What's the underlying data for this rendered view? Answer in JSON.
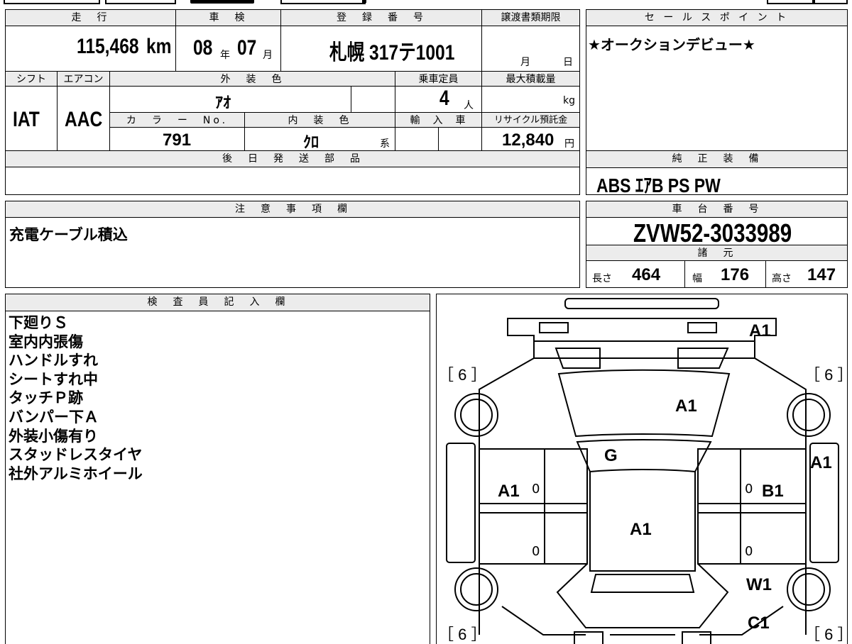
{
  "header": {
    "mileage_label": "走　行",
    "inspection_label": "車　検",
    "registration_label": "登　録　番　号",
    "transfer_label": "譲渡書類期限",
    "sales_point_label": "セ ー ル ス ポ イ ン ト"
  },
  "mileage": {
    "value": "115,468",
    "unit": "km"
  },
  "inspection": {
    "year": "08",
    "year_unit": "年",
    "month": "07",
    "month_unit": "月"
  },
  "registration": {
    "value": "札幌 317テ1001"
  },
  "transfer": {
    "month_unit": "月",
    "day_unit": "日"
  },
  "sales_point": {
    "text": "★オークションデビュー★"
  },
  "labels": {
    "shift": "シフト",
    "aircon": "エアコン",
    "exterior_color": "外　装　色",
    "capacity": "乗車定員",
    "max_load": "最大積載量",
    "color_no": "カ　ラ　ー　No.",
    "interior_color": "内　装　色",
    "import": "輸　入　車",
    "recycle": "リサイクル預託金",
    "later_parts": "後　日　発　送　部　品",
    "genuine_equipment": "純　正　装　備",
    "notes_label": "注　意　事　項　欄",
    "chassis_label": "車　台　番　号",
    "specs_label": "諸　元",
    "inspector_label": "検　査　員　記　入　欄"
  },
  "vehicle": {
    "shift": "IAT",
    "aircon": "AAC",
    "exterior_color": "ｱｵ",
    "capacity": "4",
    "capacity_unit": "人",
    "load_unit": "kg",
    "color_no": "791",
    "interior_color": "ｸﾛ",
    "interior_suffix": "系",
    "recycle_fee": "12,840",
    "recycle_unit": "円",
    "equipment": "ABS ｴｱB PS PW",
    "chassis_no": "ZVW52-3033989",
    "length_label": "長さ",
    "length": "464",
    "width_label": "幅",
    "width": "176",
    "height_label": "高さ",
    "height": "147"
  },
  "notes": {
    "text": "充電ケーブル積込"
  },
  "inspector_notes": [
    "下廻りＳ",
    "室内内張傷",
    "ハンドルすれ",
    "シートすれ中",
    "タッチＰ跡",
    "バンパー下Ａ",
    "外装小傷有り",
    "スタッドレスタイヤ",
    "社外アルミホイール"
  ],
  "diagram": {
    "tire_left_front": "［ 6 ］",
    "tire_right_front": "［ 6 ］",
    "tire_left_rear": "［ 6 ］",
    "tire_right_rear": "［ 6 ］",
    "front_bumper": "A1",
    "hood": "A1",
    "windshield": "G",
    "right_front_fender": "A1",
    "left_front_door": "A1",
    "right_front_door": "B1",
    "roof": "A1",
    "right_rear_wheel": "W1",
    "right_rear_quarter": "C1",
    "door_zero_1": "0",
    "door_zero_2": "0",
    "door_zero_3": "0",
    "door_zero_4": "0"
  }
}
